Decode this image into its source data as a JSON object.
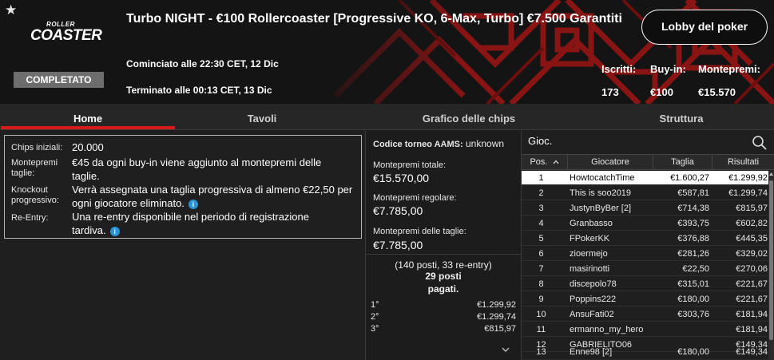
{
  "header": {
    "logo_top": "ROLLER",
    "logo_main": "COASTER",
    "status": "COMPLETATO",
    "title": "Turbo NIGHT - €100 Rollercoaster [Progressive KO, 6-Max, Turbo] €7.500 Garantiti",
    "started": "Cominciato alle 22:30 CET, 12 Dic",
    "ended": "Terminato alle 00:13 CET, 13 Dic",
    "lobby_button": "Lobby del poker",
    "stats": [
      {
        "label": "Iscritti:",
        "value": "173"
      },
      {
        "label": "Buy-in:",
        "value": "€100"
      },
      {
        "label": "Montepremi:",
        "value": "€15.570"
      }
    ],
    "accent": "#d71a1a"
  },
  "tabs": [
    {
      "label": "Home",
      "active": true
    },
    {
      "label": "Tavoli",
      "active": false
    },
    {
      "label": "Grafico delle chips",
      "active": false
    },
    {
      "label": "Struttura",
      "active": false
    }
  ],
  "info": {
    "chips_label": "Chips iniziali:",
    "chips_value": "20.000",
    "bounty_label_1": "Montepremi",
    "bounty_label_2": "taglie:",
    "bounty_value": "€45 da ogni buy-in viene aggiunto al montepremi delle taglie.",
    "knockout_label_1": "Knockout",
    "knockout_label_2": "progressivo:",
    "knockout_value": "Verrà assegnata una taglia progressiva di almeno €22,50 per ogni giocatore eliminato.",
    "reentry_label": "Re-Entry:",
    "reentry_value": "Una re-entry disponibile nel periodo di registrazione tardiva."
  },
  "prize": {
    "aams_label": "Codice torneo AAMS:",
    "aams_value": "unknown",
    "total_label": "Montepremi totale:",
    "total_value": "€15.570,00",
    "regular_label": "Montepremi regolare:",
    "regular_value": "€7.785,00",
    "bounty_label": "Montepremi delle taglie:",
    "bounty_value": "€7.785,00",
    "note": "(140 posti, 33 re-entry)",
    "paid_1": "29 posti",
    "paid_2": "pagati.",
    "payouts": [
      {
        "pos": "1°",
        "amount": "€1.299,92"
      },
      {
        "pos": "2°",
        "amount": "€1.299,74"
      },
      {
        "pos": "3°",
        "amount": "€815,97"
      }
    ]
  },
  "players": {
    "search_label": "Gioc.",
    "columns": {
      "pos": "Pos.",
      "player": "Giocatore",
      "bounty": "Taglia",
      "result": "Risultati"
    },
    "rows": [
      {
        "pos": "1",
        "name": "HowtocatchTime",
        "bounty": "€1.600,27",
        "result": "€1.299,92"
      },
      {
        "pos": "2",
        "name": "This is soo2019",
        "bounty": "€587,81",
        "result": "€1.299,74"
      },
      {
        "pos": "3",
        "name": "JustynByBer [2]",
        "bounty": "€714,38",
        "result": "€815,97"
      },
      {
        "pos": "4",
        "name": "Granbasso",
        "bounty": "€393,75",
        "result": "€602,82"
      },
      {
        "pos": "5",
        "name": "FPokerKK",
        "bounty": "€376,88",
        "result": "€445,35"
      },
      {
        "pos": "6",
        "name": "zioermejo",
        "bounty": "€281,26",
        "result": "€329,02"
      },
      {
        "pos": "7",
        "name": "masirinotti",
        "bounty": "€22,50",
        "result": "€270,06"
      },
      {
        "pos": "8",
        "name": "discepolo78",
        "bounty": "€315,01",
        "result": "€221,67"
      },
      {
        "pos": "9",
        "name": "Poppins222",
        "bounty": "€180,00",
        "result": "€221,67"
      },
      {
        "pos": "10",
        "name": "AnsuFati02",
        "bounty": "€303,76",
        "result": "€181,94"
      },
      {
        "pos": "11",
        "name": "ermanno_my_hero",
        "bounty": "",
        "result": "€181,94"
      },
      {
        "pos": "12",
        "name": "GABRIELITO06",
        "bounty": "",
        "result": "€149,34"
      },
      {
        "pos": "13",
        "name": "Enne98 [2]",
        "bounty": "€180,00",
        "result": "€149,34"
      }
    ]
  }
}
